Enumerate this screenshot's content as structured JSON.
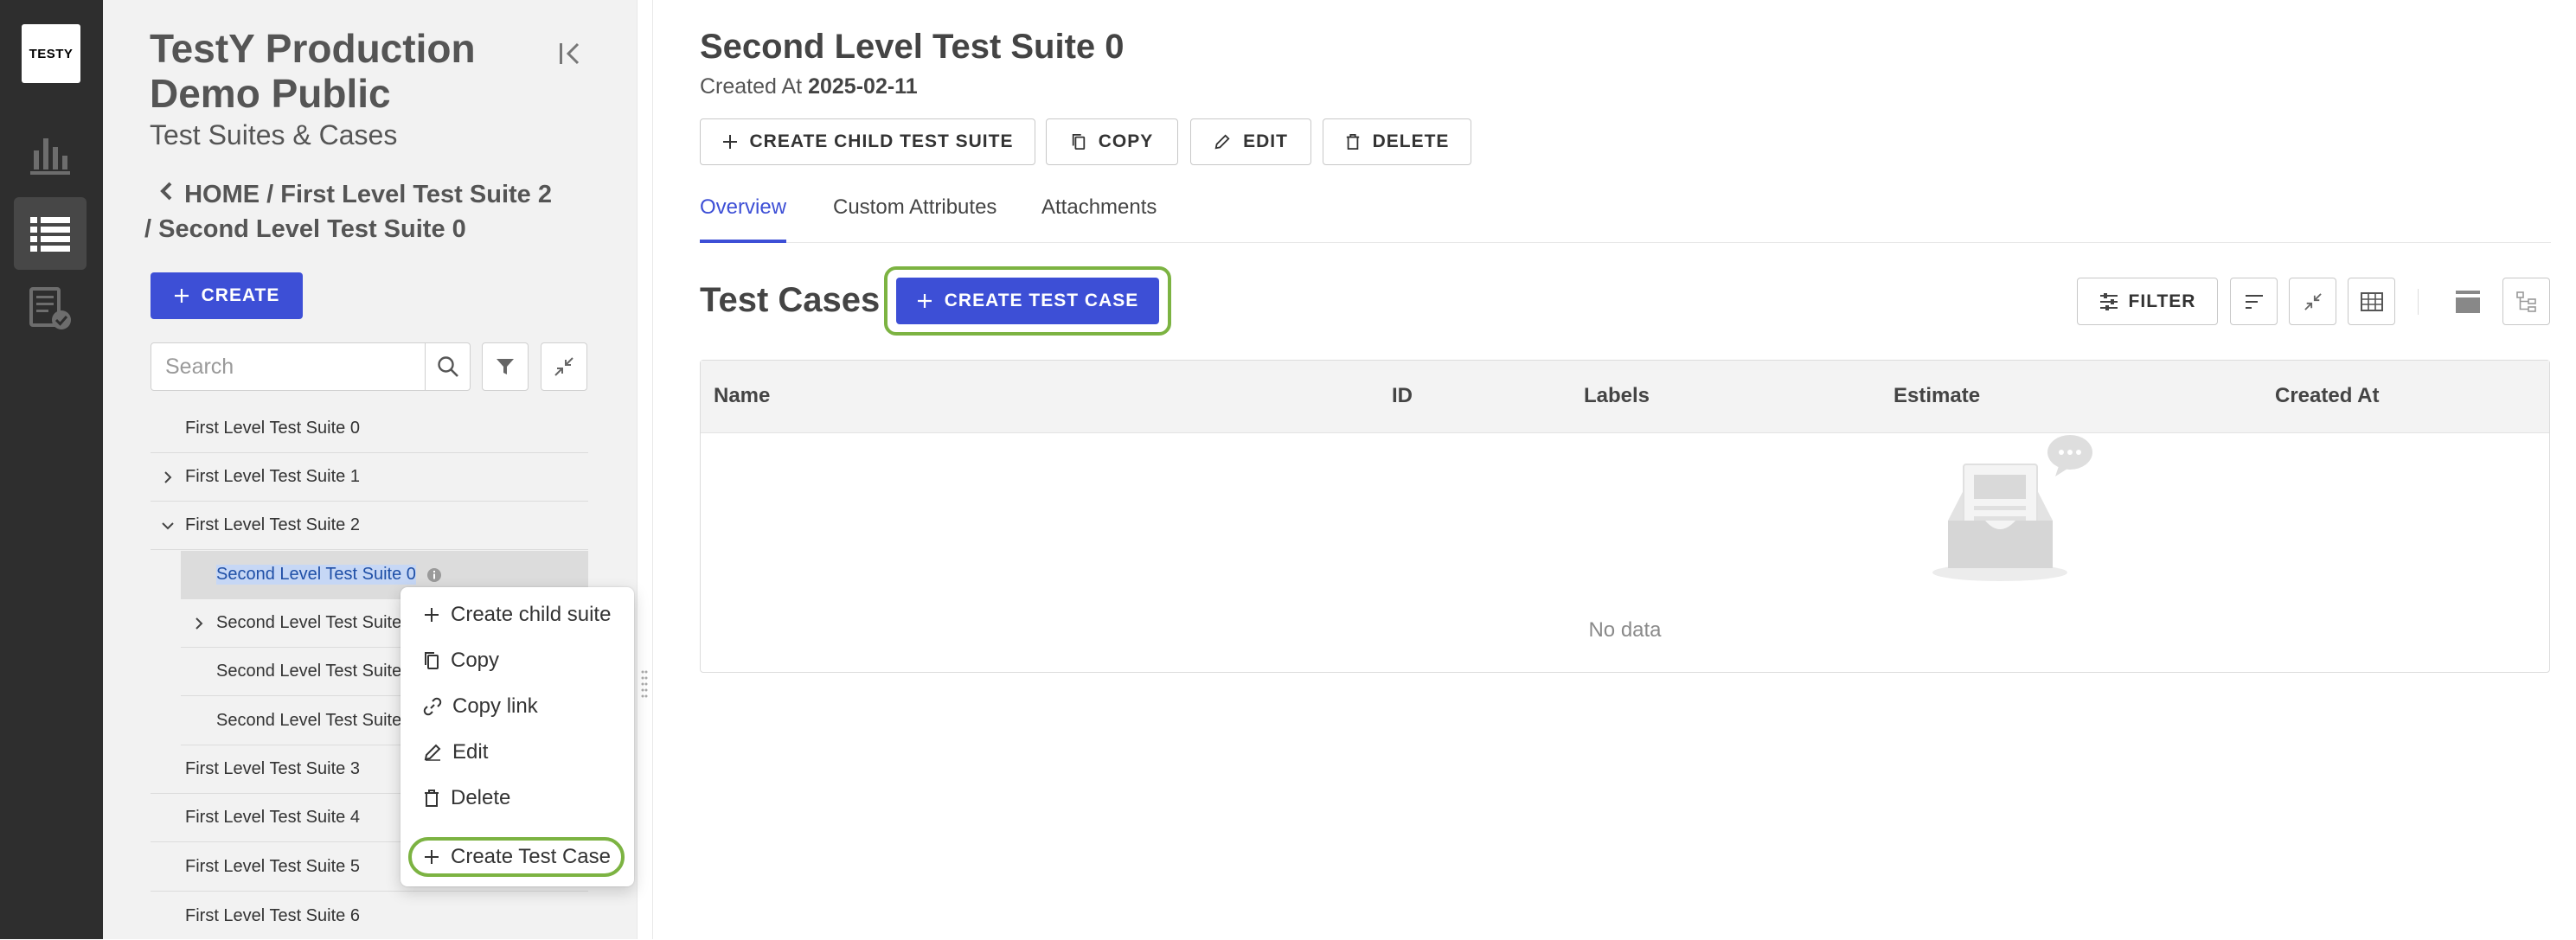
{
  "rail": {
    "logo_text": "TESTY",
    "items": [
      {
        "icon": "bar-chart-icon",
        "active": false
      },
      {
        "icon": "list-icon",
        "active": true
      },
      {
        "icon": "test-plan-icon",
        "active": false
      }
    ]
  },
  "sidebar": {
    "project_title": "TestY Production Demo Public",
    "section": "Test Suites & Cases",
    "breadcrumb": [
      "HOME",
      "First Level Test Suite 2",
      "Second Level Test Suite 0"
    ],
    "create_label": "CREATE",
    "search_placeholder": "Search",
    "tree": [
      {
        "label": "First Level Test Suite 0",
        "level": 1,
        "expandable": false
      },
      {
        "label": "First Level Test Suite 1",
        "level": 1,
        "expandable": true,
        "expanded": false
      },
      {
        "label": "First Level Test Suite 2",
        "level": 1,
        "expandable": true,
        "expanded": true
      },
      {
        "label": "Second Level Test Suite 0",
        "level": 2,
        "expandable": false,
        "selected": true
      },
      {
        "label": "Second Level Test Suite",
        "level": 2,
        "expandable": true,
        "expanded": false
      },
      {
        "label": "Second Level Test Suite",
        "level": 2,
        "expandable": false
      },
      {
        "label": "Second Level Test Suite",
        "level": 2,
        "expandable": false
      },
      {
        "label": "First Level Test Suite 3",
        "level": 1,
        "expandable": false
      },
      {
        "label": "First Level Test Suite 4",
        "level": 1,
        "expandable": false
      },
      {
        "label": "First Level Test Suite 5",
        "level": 1,
        "expandable": false
      },
      {
        "label": "First Level Test Suite 6",
        "level": 1,
        "expandable": false
      }
    ]
  },
  "context_menu": {
    "items": [
      {
        "label": "Create child suite",
        "icon": "plus-icon"
      },
      {
        "label": "Copy",
        "icon": "copy-icon"
      },
      {
        "label": "Copy link",
        "icon": "link-icon"
      },
      {
        "label": "Edit",
        "icon": "edit-icon"
      },
      {
        "label": "Delete",
        "icon": "trash-icon"
      },
      {
        "label": "Create Test Case",
        "icon": "plus-icon",
        "highlighted": true
      }
    ]
  },
  "main": {
    "title": "Second Level Test Suite 0",
    "created_label": "Created At",
    "created_value": "2025-02-11",
    "actions": [
      {
        "label": "CREATE CHILD TEST SUITE",
        "icon": "plus-icon"
      },
      {
        "label": "COPY",
        "icon": "copy-icon"
      },
      {
        "label": "EDIT",
        "icon": "edit-icon"
      },
      {
        "label": "DELETE",
        "icon": "trash-icon"
      }
    ],
    "tabs": [
      {
        "label": "Overview",
        "active": true
      },
      {
        "label": "Custom Attributes",
        "active": false
      },
      {
        "label": "Attachments",
        "active": false
      }
    ],
    "test_cases_title": "Test Cases",
    "create_test_case_label": "CREATE TEST CASE",
    "filter_label": "FILTER",
    "columns": [
      "Name",
      "ID",
      "Labels",
      "Estimate",
      "Created At"
    ],
    "empty_text": "No data"
  },
  "colors": {
    "primary": "#3d4fd6",
    "highlight_outline": "#7cb342",
    "rail_bg": "#2e2e2e",
    "sidebar_bg": "#f2f2f2"
  }
}
